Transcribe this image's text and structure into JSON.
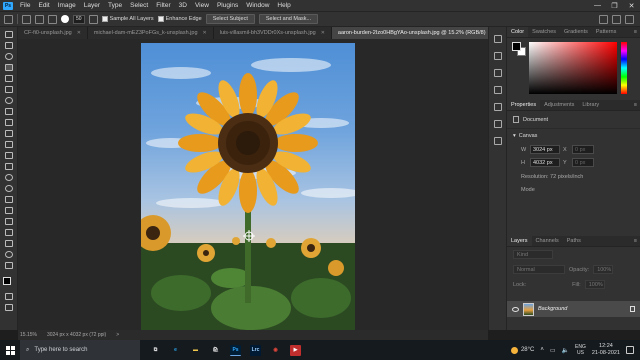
{
  "app": {
    "logo": "Ps",
    "colors": {
      "accent": "#31a8ff",
      "ui_bg": "#323232",
      "canvas_bg": "#282828"
    }
  },
  "menubar": {
    "items": [
      "File",
      "Edit",
      "Image",
      "Layer",
      "Type",
      "Select",
      "Filter",
      "3D",
      "View",
      "Plugins",
      "Window",
      "Help"
    ],
    "window_controls": [
      "—",
      "❐",
      "✕"
    ]
  },
  "options_bar": {
    "brush_size": "50",
    "sample_all_layers": "Sample All Layers",
    "enhance_edge": "Enhance Edge",
    "select_subject": "Select Subject",
    "select_and_mask": "Select and Mask..."
  },
  "tabs": [
    {
      "label": "CF-fi0-unsplash.jpg",
      "active": false
    },
    {
      "label": "michael-dam-mEZ3PoFGs_k-unsplash.jpg",
      "active": false
    },
    {
      "label": "luis-villasmil-bh3VDDr0Xs-unsplash.jpg",
      "active": false
    },
    {
      "label": "aaron-burden-2Izo0HBgYAo-unsplash.jpg @ 15.2% (RGB/8)",
      "active": true
    }
  ],
  "tabs_more": "»",
  "status_bar": {
    "zoom": "15.15%",
    "doc_info": "3024 px x 4032 px (72 ppi)",
    "arrow": ">"
  },
  "color_panel": {
    "tabs": [
      "Color",
      "Swatches",
      "Gradients",
      "Patterns"
    ],
    "active": "Color"
  },
  "properties_panel": {
    "tabs": [
      "Properties",
      "Adjustments",
      "Library"
    ],
    "active": "Properties",
    "document_label": "Document",
    "canvas_section": "Canvas",
    "width_label": "W",
    "width_value": "3024 px",
    "height_label": "H",
    "height_value": "4032 px",
    "x_label": "X",
    "x_value": "0 px",
    "y_label": "Y",
    "y_value": "0 px",
    "resolution": "Resolution: 72 pixels/inch",
    "mode_label": "Mode"
  },
  "layers_panel": {
    "tabs": [
      "Layers",
      "Channels",
      "Paths"
    ],
    "active": "Layers",
    "filter_placeholder": "Kind",
    "blend_mode": "Normal",
    "opacity_label": "Opacity:",
    "opacity_value": "100%",
    "lock_label": "Lock:",
    "fill_label": "Fill:",
    "fill_value": "100%",
    "layer_name": "Background"
  },
  "taskbar": {
    "search_placeholder": "Type here to search",
    "apps": [
      {
        "name": "task-view",
        "glyph": "⧉",
        "color": "#ddd"
      },
      {
        "name": "edge",
        "glyph": "e",
        "color": "#2aa3e8"
      },
      {
        "name": "file-explorer",
        "glyph": "▬",
        "color": "#f2c94c"
      },
      {
        "name": "store",
        "glyph": "🛍",
        "color": "#ddd"
      },
      {
        "name": "photoshop",
        "glyph": "Ps",
        "color": "#31a8ff"
      },
      {
        "name": "lightroom-classic",
        "glyph": "Lrc",
        "color": "#9fd0ff"
      },
      {
        "name": "chrome",
        "glyph": "◉",
        "color": "#e0463b"
      },
      {
        "name": "media-encoder",
        "glyph": "▶",
        "color": "#c12e2e"
      }
    ],
    "weather": "28°C",
    "lang_line1": "ENG",
    "lang_line2": "US",
    "time": "12:24",
    "date": "21-08-2021"
  }
}
